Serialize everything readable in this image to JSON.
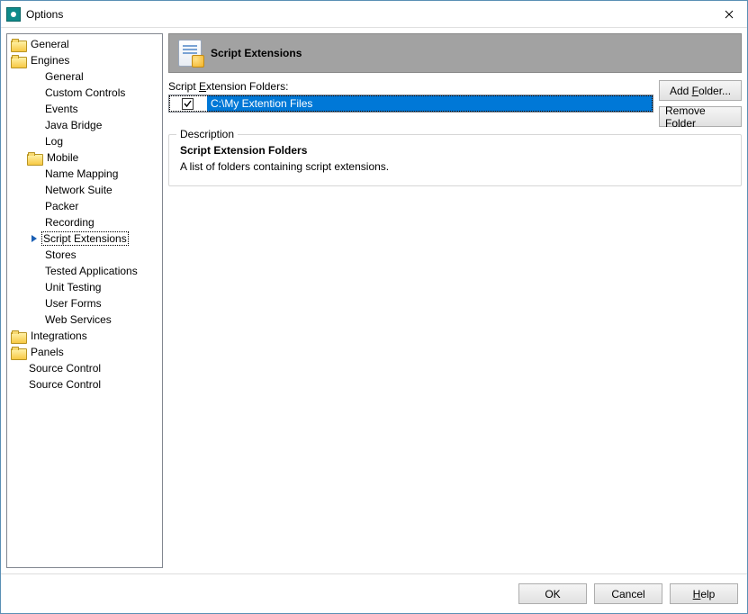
{
  "window": {
    "title": "Options"
  },
  "tree": {
    "items": [
      {
        "level": 0,
        "label": "General",
        "folder": true
      },
      {
        "level": 0,
        "label": "Engines",
        "folder": true
      },
      {
        "level": 2,
        "label": "General"
      },
      {
        "level": 2,
        "label": "Custom Controls"
      },
      {
        "level": 2,
        "label": "Events"
      },
      {
        "level": 2,
        "label": "Java Bridge"
      },
      {
        "level": 2,
        "label": "Log"
      },
      {
        "level": 1,
        "label": "Mobile",
        "folder": true
      },
      {
        "level": 2,
        "label": "Name Mapping"
      },
      {
        "level": 2,
        "label": "Network Suite"
      },
      {
        "level": 2,
        "label": "Packer"
      },
      {
        "level": 2,
        "label": "Recording"
      },
      {
        "level": 2,
        "label": "Script Extensions",
        "selected": true
      },
      {
        "level": 2,
        "label": "Stores"
      },
      {
        "level": 2,
        "label": "Tested Applications"
      },
      {
        "level": 2,
        "label": "Unit Testing"
      },
      {
        "level": 2,
        "label": "User Forms"
      },
      {
        "level": 2,
        "label": "Web Services"
      },
      {
        "level": 0,
        "label": "Integrations",
        "folder": true
      },
      {
        "level": 0,
        "label": "Panels",
        "folder": true
      },
      {
        "level": 1,
        "label": "Source Control"
      },
      {
        "level": 1,
        "label": "Source Control"
      }
    ]
  },
  "header": {
    "title": "Script Extensions"
  },
  "folders": {
    "label": "Script Extension Folders:",
    "items": [
      {
        "checked": true,
        "path": "C:\\My Extention Files",
        "selected": true
      }
    ]
  },
  "buttons": {
    "add": "Add Folder...",
    "remove": "Remove Folder"
  },
  "description": {
    "legend": "Description",
    "title": "Script Extension Folders",
    "body": "A list of folders containing script extensions."
  },
  "footer": {
    "ok": "OK",
    "cancel": "Cancel",
    "help": "Help"
  }
}
